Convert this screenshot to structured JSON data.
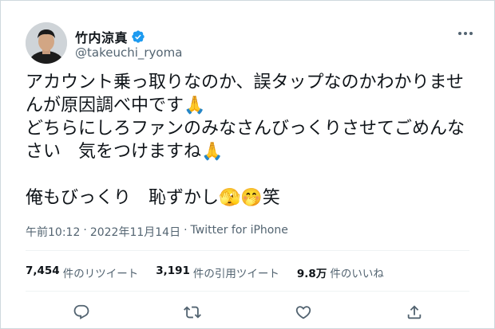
{
  "author": {
    "display_name": "竹内涼真",
    "handle": "@takeuchi_ryoma",
    "verified": true,
    "avatar_icon": "avatar-photo",
    "more_icon": "more-dots-icon"
  },
  "tweet": {
    "text": "アカウント乗っ取りなのか、誤タップなのかわかりませんが原因調べ中です🙏\nどちらにしろファンのみなさんびっくりさせてごめんなさい　気をつけますね🙏\n\n俺もびっくり　恥ずかし🫣🤭笑"
  },
  "meta": {
    "time": "午前10:12",
    "separator1": "·",
    "date": "2022年11月14日",
    "separator2": "·",
    "source": "Twitter for iPhone"
  },
  "stats": {
    "retweets_count": "7,454",
    "retweets_label": "件のリツイート",
    "quotes_count": "3,191",
    "quotes_label": "件の引用ツイート",
    "likes_count": "9.8万",
    "likes_label": "件のいいね"
  },
  "actions": [
    {
      "name": "reply",
      "icon": "reply-icon"
    },
    {
      "name": "retweet",
      "icon": "retweet-icon"
    },
    {
      "name": "like",
      "icon": "heart-icon"
    },
    {
      "name": "share",
      "icon": "share-icon"
    }
  ],
  "colors": {
    "verified": "#1d9bf0",
    "text": "#0f1419",
    "secondary": "#536471"
  }
}
